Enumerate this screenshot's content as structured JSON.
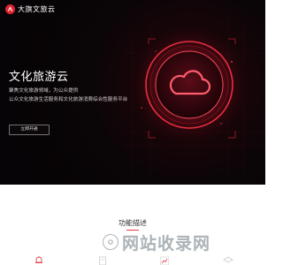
{
  "brand": {
    "name": "大旗文旅云",
    "accent_color": "#e02434"
  },
  "hero": {
    "title": "文化旅游云",
    "description_line1": "聚焦文化旅游领域，为公众提供",
    "description_line2": "公众文化旅游生活服务和文化旅游消费综合性服务平台",
    "button_label": "立即开通",
    "graphic_icon": "cloud-icon"
  },
  "features": {
    "title": "功能描述",
    "items": [
      {
        "icon": "bell-icon"
      },
      {
        "icon": "document-icon"
      },
      {
        "icon": "chart-icon"
      },
      {
        "icon": "layers-icon"
      }
    ]
  },
  "watermark": {
    "text": "网站收录网"
  }
}
